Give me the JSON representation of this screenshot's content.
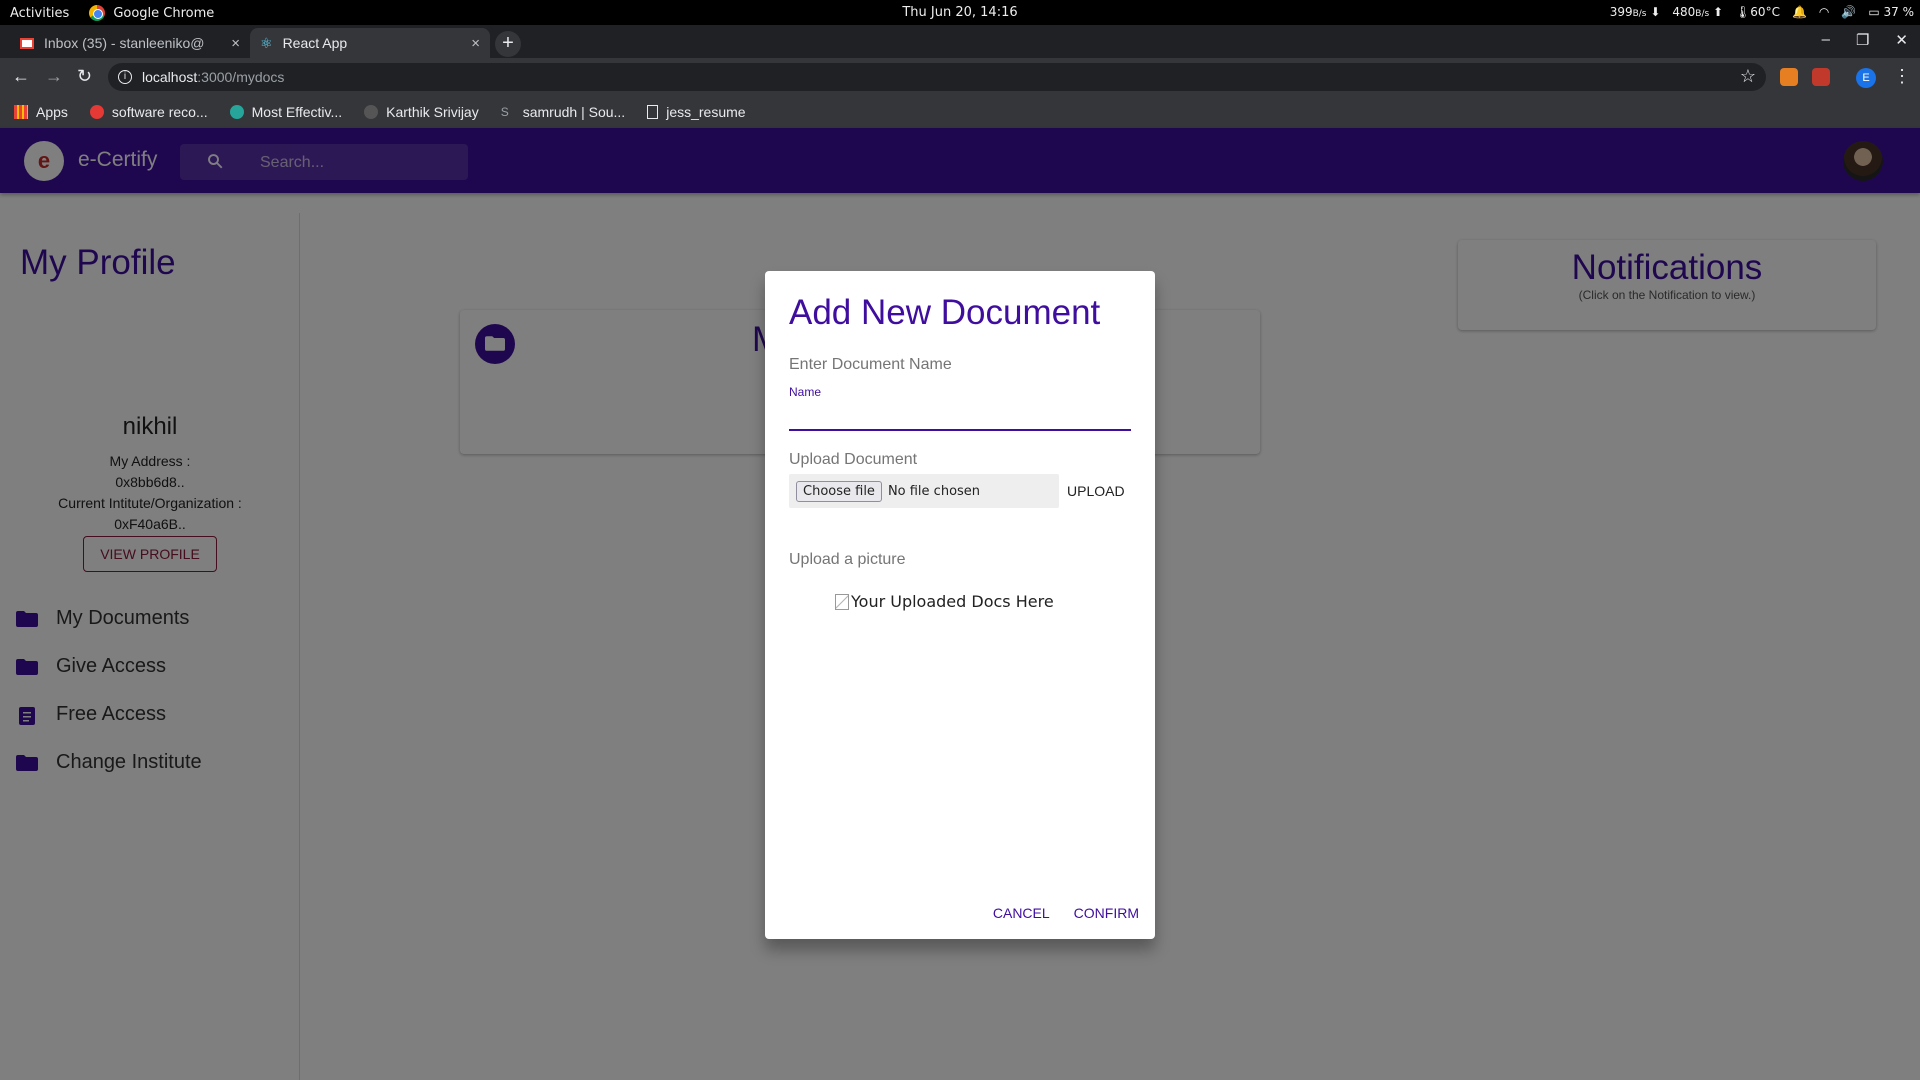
{
  "os": {
    "activities": "Activities",
    "app_name": "Google Chrome",
    "clock": "Thu Jun 20, 14:16",
    "net_down": "399",
    "net_down_unit": "B/s",
    "net_up": "480",
    "net_up_unit": "B/s",
    "temp": "60°C",
    "battery": "37 %"
  },
  "browser": {
    "tabs": [
      {
        "title": "Inbox (35) - stanleeniko@",
        "icon": "gmail-icon"
      },
      {
        "title": "React App",
        "icon": "react-icon"
      }
    ],
    "url_host": "localhost",
    "url_path": ":3000/mydocs",
    "profile_letter": "E",
    "bookmarks": [
      {
        "label": "Apps"
      },
      {
        "label": "software reco..."
      },
      {
        "label": "Most Effectiv..."
      },
      {
        "label": "Karthik Srivijay"
      },
      {
        "label": "samrudh | Sou..."
      },
      {
        "label": "jess_resume"
      }
    ]
  },
  "app": {
    "brand": "e-Certify",
    "logo_glyph": "e",
    "search_placeholder": "Search...",
    "sidebar": {
      "heading": "My Profile",
      "name": "nikhil",
      "address_label": "My Address :",
      "address_value": "0x8bb6d8..",
      "institute_label": "Current Intitute/Organization :",
      "institute_value": "0xF40a6B..",
      "view_profile": "VIEW PROFILE",
      "items": [
        {
          "label": "My Documents",
          "icon": "folder-icon"
        },
        {
          "label": "Give Access",
          "icon": "folder-icon"
        },
        {
          "label": "Free Access",
          "icon": "clipboard-icon"
        },
        {
          "label": "Change Institute",
          "icon": "folder-icon"
        }
      ]
    },
    "main_card_title_partial": "M",
    "notifications": {
      "title": "Notifications",
      "subtitle": "(Click on the Notification to view.)"
    }
  },
  "dialog": {
    "title": "Add New Document",
    "doc_name_label": "Enter Document Name",
    "name_field_label": "Name",
    "name_value": "",
    "upload_label": "Upload Document",
    "choose_file": "Choose file",
    "no_file": "No file chosen",
    "upload_button": "UPLOAD",
    "picture_label": "Upload a picture",
    "image_alt": "Your Uploaded Docs Here",
    "cancel": "CANCEL",
    "confirm": "CONFIRM"
  },
  "colors": {
    "primary": "#3f0e9e",
    "outline_button": "#8b1a3a"
  }
}
